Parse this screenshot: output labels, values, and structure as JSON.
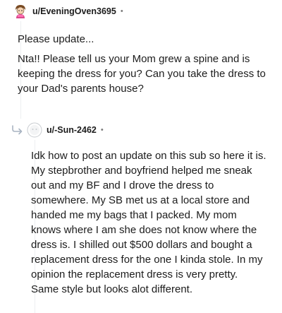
{
  "comments": [
    {
      "username": "u/EveningOven3695",
      "separator": "•",
      "avatar_icon": "cartoon-character-avatar",
      "paragraphs": [
        "Please update...",
        "Nta!! Please tell us your Mom grew a spine and is keeping the dress for you? Can you take the dress to your Dad's parents house?"
      ]
    },
    {
      "username": "u/-Sun-2462",
      "separator": "•",
      "avatar_icon": "default-user-avatar",
      "reply_icon": "reply-arrow-icon",
      "paragraphs": [
        "Idk how to post an update on this sub so here it is. My stepbrother and boyfriend helped me sneak out and my BF and I drove the dress to somewhere. My SB met us at a local store and handed me my bags that I packed. My mom knows where I am she does not know where the dress is. I shilled out $500 dollars and bought a replacement dress for the one I kinda stole. In my opinion the replacement dress is very pretty. Same style but looks alot different."
      ]
    }
  ],
  "colors": {
    "text": "#1c1c1c",
    "meta": "#7c7c7c",
    "thread_line": "#edeff1"
  }
}
